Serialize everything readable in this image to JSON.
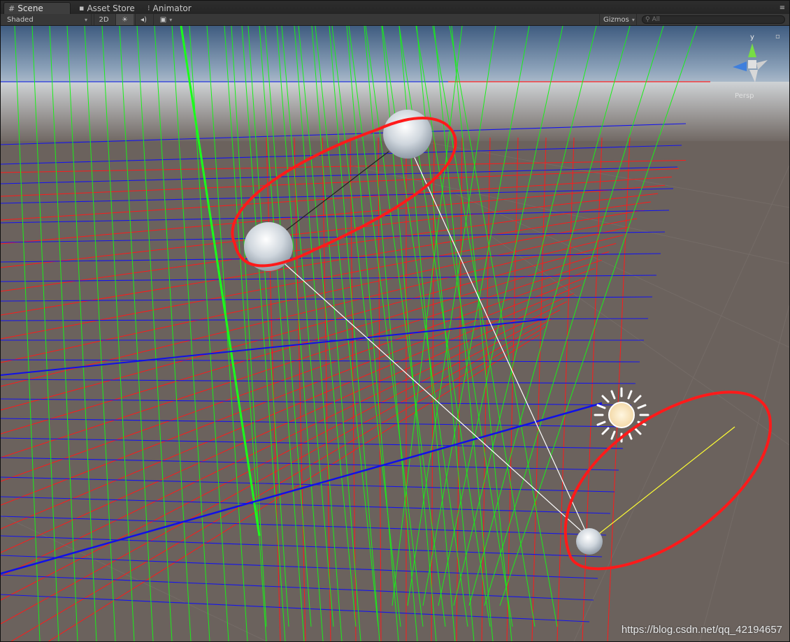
{
  "tabs": [
    {
      "label": "Scene",
      "icon": "grid-icon",
      "active": true
    },
    {
      "label": "Asset Store",
      "icon": "bag-icon",
      "active": false
    },
    {
      "label": "Animator",
      "icon": "animator-icon",
      "active": false
    }
  ],
  "toolbar": {
    "shading_mode": "Shaded",
    "mode_2d_label": "2D",
    "gizmos_label": "Gizmos",
    "search_placeholder": "All"
  },
  "viewport": {
    "projection_label": "Persp",
    "gizmo_axis_label": "y"
  },
  "watermark": "https://blog.csdn.net/qq_42194657",
  "colors": {
    "x_axis": "#ff1a1a",
    "y_axis": "#1aff1a",
    "z_axis": "#1a1aff",
    "annotation": "#ff1a1a",
    "light_ray": "#ffff33",
    "background": "#6b625d"
  }
}
